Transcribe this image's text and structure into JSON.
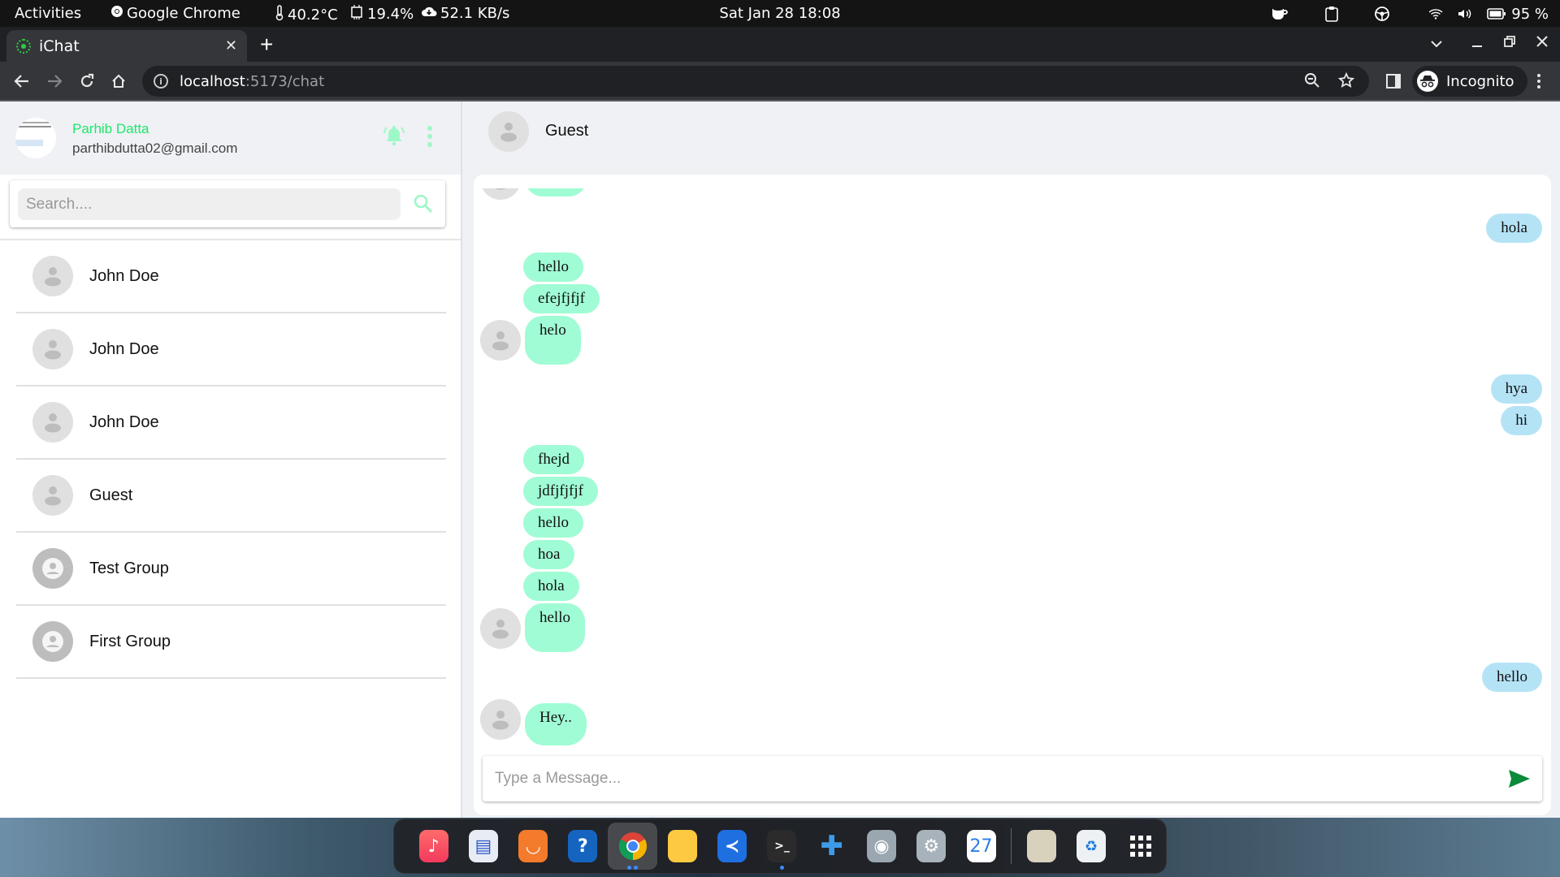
{
  "system_bar": {
    "activities": "Activities",
    "app_name": "Google Chrome",
    "temperature": "40.2°C",
    "cpu": "19.4%",
    "network": "52.1 KB/s",
    "clock": "Sat Jan 28  18:08",
    "battery": "95 %"
  },
  "browser": {
    "tab_title": "iChat",
    "url_host": "localhost",
    "url_path": ":5173/chat",
    "profile_label": "Incognito"
  },
  "user": {
    "name": "Parhib Datta",
    "email": "parthibdutta02@gmail.com"
  },
  "search": {
    "placeholder": "Search...."
  },
  "contacts": [
    {
      "name": "John Doe",
      "type": "person"
    },
    {
      "name": "John Doe",
      "type": "person"
    },
    {
      "name": "John Doe",
      "type": "person"
    },
    {
      "name": "Guest",
      "type": "person"
    },
    {
      "name": "Test Group",
      "type": "group"
    },
    {
      "name": "First Group",
      "type": "group"
    }
  ],
  "chat": {
    "recipient": "Guest",
    "messages": [
      {
        "text": "",
        "direction": "in",
        "partial": true
      },
      {
        "text": "hola",
        "direction": "out"
      },
      {
        "text": "hello",
        "direction": "in"
      },
      {
        "text": "efejfjfjf",
        "direction": "in"
      },
      {
        "text": "helo",
        "direction": "in"
      },
      {
        "text": "hya",
        "direction": "out"
      },
      {
        "text": "hi",
        "direction": "out"
      },
      {
        "text": "fhejd",
        "direction": "in"
      },
      {
        "text": "jdfjfjfjf",
        "direction": "in"
      },
      {
        "text": "hello",
        "direction": "in"
      },
      {
        "text": "hoa",
        "direction": "in"
      },
      {
        "text": "hola",
        "direction": "in"
      },
      {
        "text": "hello",
        "direction": "in"
      },
      {
        "text": "hello",
        "direction": "out"
      },
      {
        "text": "Hey..",
        "direction": "in"
      }
    ],
    "composer_placeholder": "Type a Message..."
  },
  "colors": {
    "incoming_bubble": "#a0fcd4",
    "outgoing_bubble": "#b5e3f6",
    "accent_green": "#1ee86a",
    "send_green": "#0b8a3a"
  },
  "dock": {
    "apps": [
      "rhythmbox",
      "libreoffice-writer",
      "software-center",
      "help",
      "google-chrome",
      "files",
      "vscode",
      "terminal",
      "extensions",
      "tweaks",
      "settings",
      "calendar",
      "disk-usage",
      "trash",
      "show-apps"
    ],
    "calendar_day": "27"
  }
}
